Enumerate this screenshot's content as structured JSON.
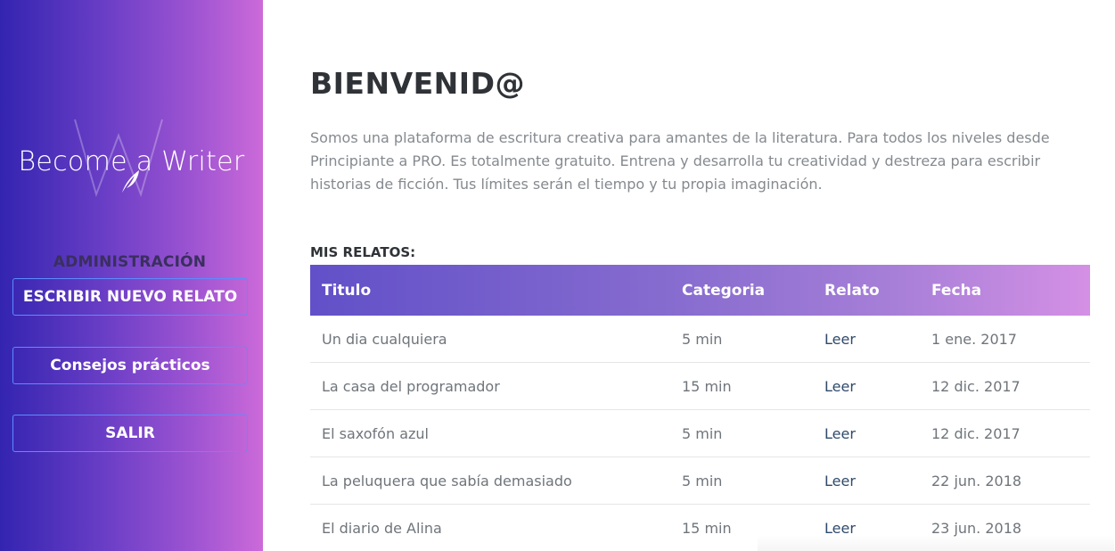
{
  "sidebar": {
    "logo_text": "Become a Writer",
    "admin_label": "ADMINISTRACIÓN",
    "buttons": [
      {
        "label": "ESCRIBIR NUEVO RELATO"
      },
      {
        "label": "Consejos prácticos"
      },
      {
        "label": "SALIR"
      }
    ]
  },
  "main": {
    "title": "BIENVENID@",
    "intro": "Somos una plataforma de escritura creativa para amantes de la literatura. Para todos los niveles desde Principiante a PRO. Es totalmente gratuito. Entrena y desarrolla tu creatividad y destreza para escribir historias de ficción. Tus límites serán el tiempo y tu propia imaginación.",
    "section_label": "MIS RELATOS:",
    "table": {
      "headers": [
        "Titulo",
        "Categoria",
        "Relato",
        "Fecha"
      ],
      "rows": [
        {
          "titulo": "Un dia cualquiera",
          "categoria": "5 min",
          "relato": "Leer",
          "fecha": "1 ene. 2017"
        },
        {
          "titulo": "La casa del programador",
          "categoria": "15 min",
          "relato": "Leer",
          "fecha": "12 dic. 2017"
        },
        {
          "titulo": "El saxofón azul",
          "categoria": "5 min",
          "relato": "Leer",
          "fecha": "12 dic. 2017"
        },
        {
          "titulo": "La peluquera que sabía demasiado",
          "categoria": "5 min",
          "relato": "Leer",
          "fecha": "22 jun. 2018"
        },
        {
          "titulo": "El diario de Alina",
          "categoria": "15 min",
          "relato": "Leer",
          "fecha": "23 jun. 2018"
        }
      ]
    }
  },
  "colors": {
    "sidebar_start": "#3324b0",
    "sidebar_end": "#cc6ad9",
    "button_border": "#5c8cff",
    "header_start": "#6150c8",
    "header_end": "#d490e5"
  }
}
